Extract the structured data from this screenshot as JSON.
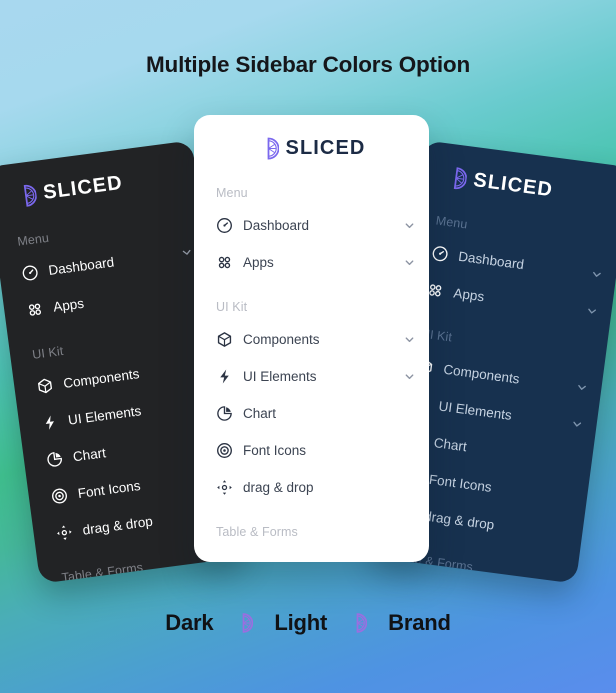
{
  "page": {
    "title": "Multiple Sidebar Colors Option",
    "background_colors": [
      "#a8d8ef",
      "#3fbf8e",
      "#5a8ded"
    ]
  },
  "brand": {
    "logo_text": "SLICED",
    "logo_icon": "citrus-slice-icon",
    "logo_color": "#7b68ee"
  },
  "sidebar": {
    "sections": [
      {
        "label": "Menu",
        "items": [
          {
            "label": "Dashboard",
            "icon": "gauge-icon",
            "chevron": true
          },
          {
            "label": "Apps",
            "icon": "grid-dots-icon",
            "chevron": true
          }
        ]
      },
      {
        "label": "UI Kit",
        "items": [
          {
            "label": "Components",
            "icon": "cube-icon",
            "chevron": true
          },
          {
            "label": "UI Elements",
            "icon": "lightning-bolt-icon",
            "chevron": true
          },
          {
            "label": "Chart",
            "icon": "pie-chart-icon",
            "chevron": false
          },
          {
            "label": "Font Icons",
            "icon": "at-sign-icon",
            "chevron": false
          },
          {
            "label": "drag & drop",
            "icon": "move-arrows-icon",
            "chevron": false
          }
        ]
      },
      {
        "label": "Table & Forms",
        "items": []
      }
    ]
  },
  "cards": [
    {
      "name": "Dark",
      "theme": "dark",
      "bg": "#222325"
    },
    {
      "name": "Light",
      "theme": "light",
      "bg": "#ffffff"
    },
    {
      "name": "Brand",
      "theme": "brand",
      "bg": "#17314f"
    }
  ],
  "legend": {
    "dark_label": "Dark",
    "light_label": "Light",
    "brand_label": "Brand",
    "separator_icon": "citrus-slice-icon",
    "separator_color": "#9b6ee0"
  }
}
